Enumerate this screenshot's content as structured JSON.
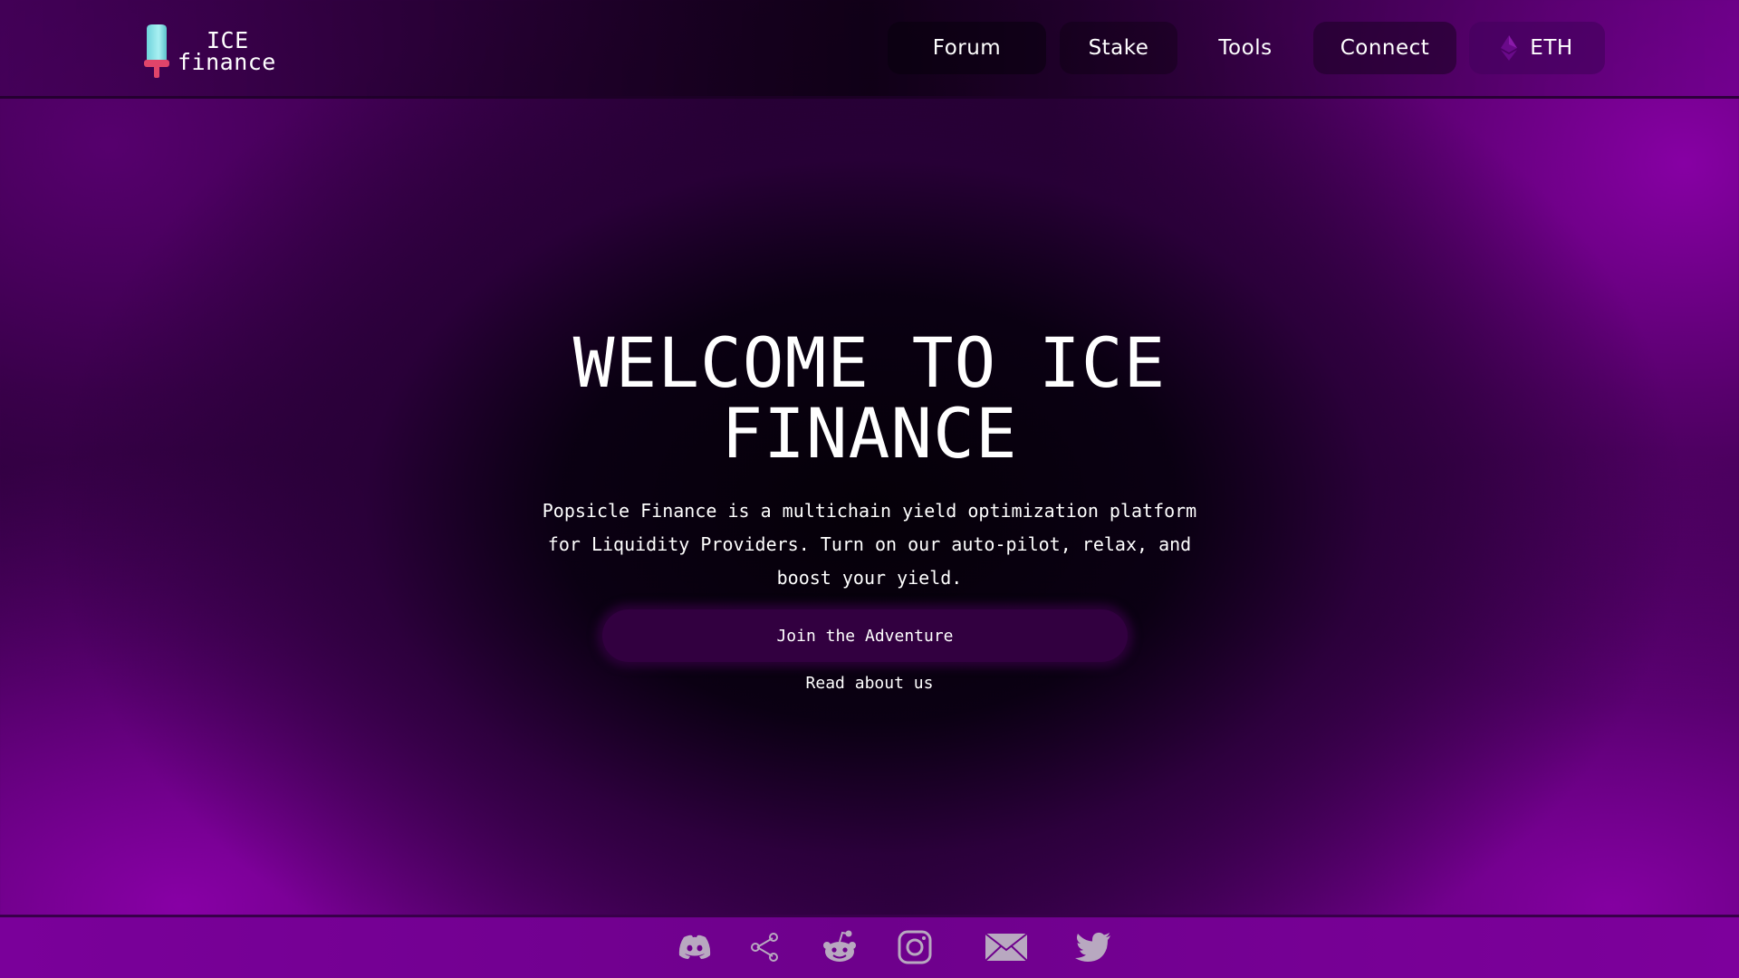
{
  "header": {
    "logo": {
      "line1": "ICE",
      "line2": "finance"
    },
    "nav": {
      "forum": "Forum",
      "stake": "Stake",
      "tools": "Tools",
      "connect": "Connect",
      "network": "ETH"
    }
  },
  "hero": {
    "title": "WELCOME TO ICE FINANCE",
    "description": "Popsicle Finance is a multichain yield optimization platform for Liquidity Providers. Turn on our auto-pilot, relax, and boost your yield.",
    "cta_label": "Join the Adventure",
    "secondary_link": "Read about us"
  },
  "footer": {
    "social_icons": [
      "discord-icon",
      "share-icon",
      "reddit-icon",
      "instagram-icon",
      "mail-icon",
      "twitter-icon"
    ]
  },
  "colors": {
    "brand_purple": "#7a009a",
    "button_bg": "#320040",
    "icon_gray": "#b8a8c0",
    "popsicle_top": "#8fe3e8",
    "popsicle_stick": "#e0446a"
  }
}
